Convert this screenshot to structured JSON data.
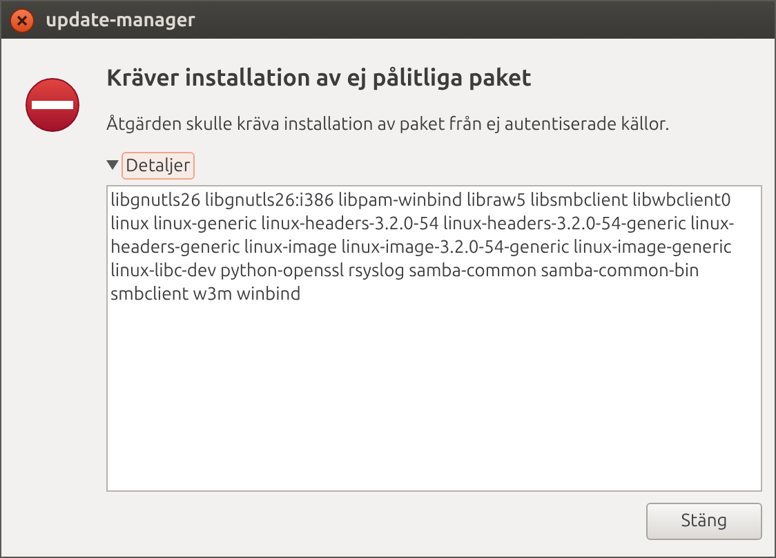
{
  "window": {
    "title": "update-manager"
  },
  "heading": "Kräver installation av ej pålitliga paket",
  "message": "Åtgärden skulle kräva installation av paket från ej autentiserade källor.",
  "details": {
    "label": "Detaljer",
    "expanded": true,
    "text": "libgnutls26 libgnutls26:i386 libpam-winbind libraw5 libsmbclient libwbclient0 linux linux-generic linux-headers-3.2.0-54 linux-headers-3.2.0-54-generic linux-headers-generic linux-image linux-image-3.2.0-54-generic linux-image-generic linux-libc-dev python-openssl rsyslog samba-common samba-common-bin smbclient w3m winbind"
  },
  "buttons": [
    "Stäng"
  ]
}
